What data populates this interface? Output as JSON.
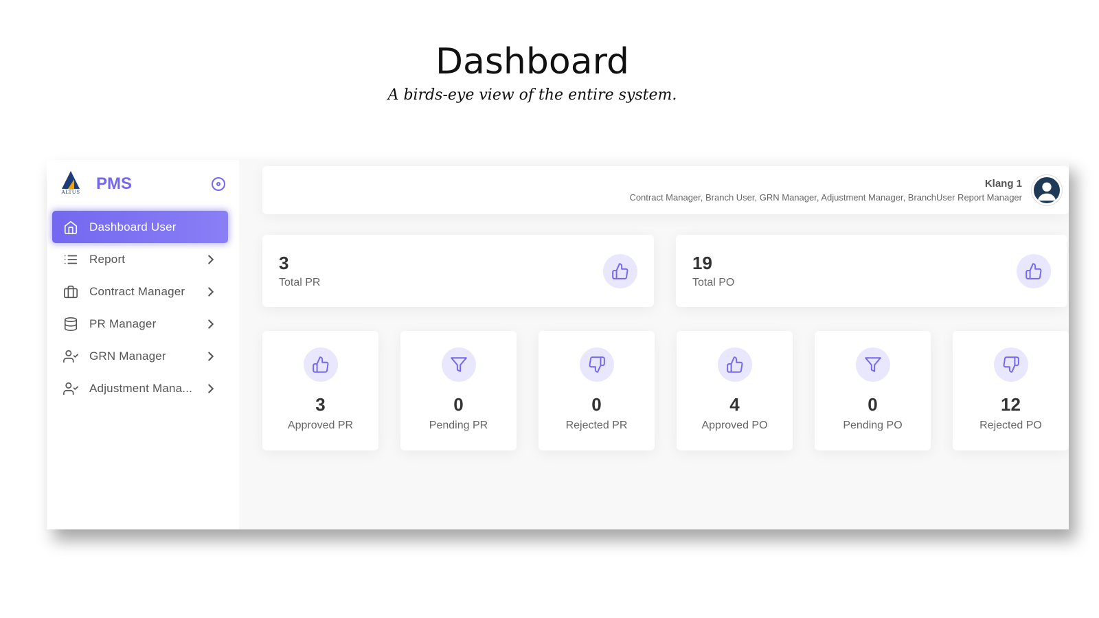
{
  "slide": {
    "title": "Dashboard",
    "subtitle": "A birds-eye view of the entire system."
  },
  "brand": {
    "logo_text": "ALTUS",
    "name": "PMS",
    "accent": "#7367f0"
  },
  "sidebar": {
    "items": [
      {
        "label": "Dashboard User",
        "icon": "home-icon",
        "active": true
      },
      {
        "label": "Report",
        "icon": "list-icon"
      },
      {
        "label": "Contract Manager",
        "icon": "briefcase-icon"
      },
      {
        "label": "PR Manager",
        "icon": "database-icon"
      },
      {
        "label": "GRN Manager",
        "icon": "user-check-icon"
      },
      {
        "label": "Adjustment Mana...",
        "icon": "user-check-icon"
      }
    ]
  },
  "header": {
    "user_name": "Klang 1",
    "roles": "Contract Manager, Branch User, GRN Manager, Adjustment Manager, BranchUser Report Manager"
  },
  "summary": [
    {
      "value": "3",
      "label": "Total PR",
      "icon": "thumbs-up-icon"
    },
    {
      "value": "19",
      "label": "Total PO",
      "icon": "thumbs-up-icon"
    }
  ],
  "stats": [
    {
      "value": "3",
      "label": "Approved PR",
      "icon": "thumbs-up-icon"
    },
    {
      "value": "0",
      "label": "Pending PR",
      "icon": "filter-icon"
    },
    {
      "value": "0",
      "label": "Rejected PR",
      "icon": "thumbs-down-icon"
    },
    {
      "value": "4",
      "label": "Approved PO",
      "icon": "thumbs-up-icon"
    },
    {
      "value": "0",
      "label": "Pending PO",
      "icon": "filter-icon"
    },
    {
      "value": "12",
      "label": "Rejected PO",
      "icon": "thumbs-down-icon"
    }
  ]
}
